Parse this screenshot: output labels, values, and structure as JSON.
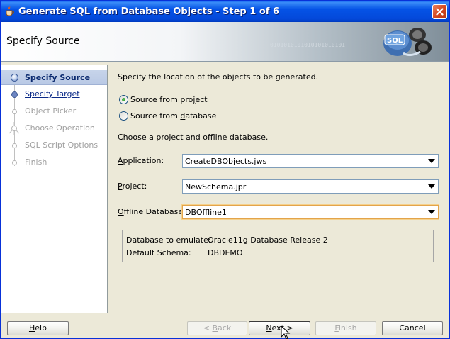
{
  "window": {
    "title": "Generate SQL from Database Objects - Step 1 of 6",
    "close_icon": "close-icon",
    "title_color": "#0553e6"
  },
  "header": {
    "title": "Specify Source",
    "binary_text": "0101010101010101010101",
    "graphic_icon": "sql-database-icon"
  },
  "steps": [
    {
      "label": "Specify Source",
      "state": "active"
    },
    {
      "label": "Specify Target",
      "state": "link"
    },
    {
      "label": "Object Picker",
      "state": "disabled"
    },
    {
      "label": "Choose Operation",
      "state": "disabled"
    },
    {
      "label": "SQL Script Options",
      "state": "disabled"
    },
    {
      "label": "Finish",
      "state": "disabled"
    }
  ],
  "content": {
    "intro": "Specify the location of the objects to be generated.",
    "radio_project": {
      "pre": "Source from pro",
      "mnemonic": "j",
      "post": "ect",
      "checked": true
    },
    "radio_database": {
      "pre": "Source from ",
      "mnemonic": "d",
      "post": "atabase",
      "checked": false
    },
    "choose_text": "Choose a project and offline database.",
    "application": {
      "mnemonic": "A",
      "rest": "pplication:",
      "value": "CreateDBObjects.jws"
    },
    "project": {
      "mnemonic": "P",
      "rest": "roject:",
      "value": "NewSchema.jpr"
    },
    "offline": {
      "mnemonic": "O",
      "rest": "ffline Database:",
      "value": "DBOffline1"
    },
    "info": {
      "emulate_label": "Database to emulate:",
      "emulate_value": "Oracle11g Database Release 2",
      "schema_label": "Default Schema:",
      "schema_value": "DBDEMO"
    }
  },
  "buttons": {
    "help": {
      "mnemonic": "H",
      "rest": "elp"
    },
    "back": {
      "pre": "< ",
      "mnemonic": "B",
      "rest": "ack"
    },
    "next": {
      "pre": "",
      "mnemonic": "N",
      "rest": "ext >"
    },
    "finish": {
      "mnemonic": "F",
      "rest": "inish"
    },
    "cancel": "Cancel"
  }
}
